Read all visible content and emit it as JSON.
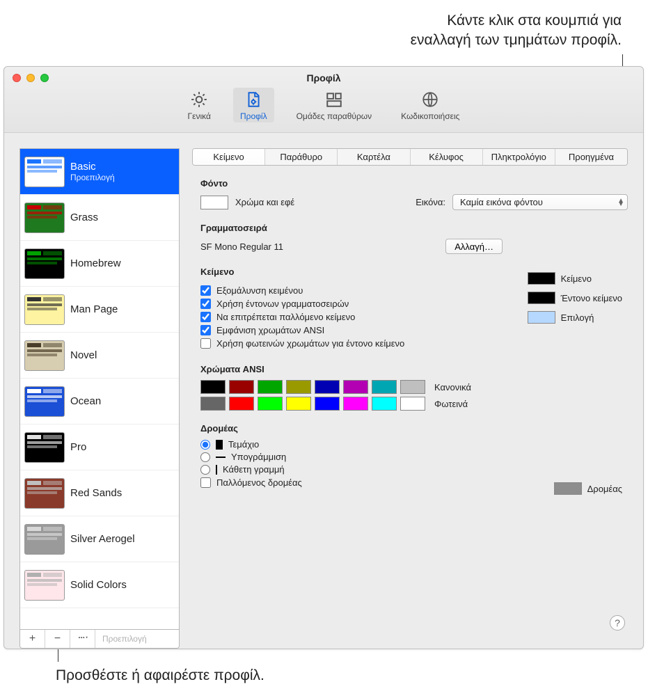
{
  "callouts": {
    "top": "Κάντε κλικ στα κουμπιά για\nεναλλαγή των τμημάτων προφίλ.",
    "bottom": "Προσθέστε ή αφαιρέστε προφίλ."
  },
  "window": {
    "title": "Προφίλ",
    "toolbar": [
      {
        "label": "Γενικά",
        "selected": false
      },
      {
        "label": "Προφίλ",
        "selected": true
      },
      {
        "label": "Ομάδες παραθύρων",
        "selected": false
      },
      {
        "label": "Κωδικοποιήσεις",
        "selected": false
      }
    ]
  },
  "sidebar": {
    "profiles": [
      {
        "name": "Basic",
        "default_label": "Προεπιλογή",
        "selected": true,
        "bg": "#ffffff",
        "accent": "#1a73ff"
      },
      {
        "name": "Grass",
        "selected": false,
        "bg": "#1f7a1f",
        "accent": "#c60000"
      },
      {
        "name": "Homebrew",
        "selected": false,
        "bg": "#000000",
        "accent": "#00a000"
      },
      {
        "name": "Man Page",
        "selected": false,
        "bg": "#fdf3a0",
        "accent": "#333333"
      },
      {
        "name": "Novel",
        "selected": false,
        "bg": "#d7cdb0",
        "accent": "#4a3d2a"
      },
      {
        "name": "Ocean",
        "selected": false,
        "bg": "#1a4fd6",
        "accent": "#ffffff"
      },
      {
        "name": "Pro",
        "selected": false,
        "bg": "#000000",
        "accent": "#e0e0e0"
      },
      {
        "name": "Red Sands",
        "selected": false,
        "bg": "#8a3a2a",
        "accent": "#c0c0c0"
      },
      {
        "name": "Silver Aerogel",
        "selected": false,
        "bg": "#9a9a9a",
        "accent": "#d8d8d8"
      },
      {
        "name": "Solid Colors",
        "selected": false,
        "bg": "#ffe6ea",
        "accent": "#b0b0b0"
      }
    ],
    "footer_default": "Προεπιλογή"
  },
  "tabs": [
    {
      "label": "Κείμενο",
      "current": true
    },
    {
      "label": "Παράθυρο",
      "current": false
    },
    {
      "label": "Καρτέλα",
      "current": false
    },
    {
      "label": "Κέλυφος",
      "current": false
    },
    {
      "label": "Πληκτρολόγιο",
      "current": false
    },
    {
      "label": "Προηγμένα",
      "current": false
    }
  ],
  "background": {
    "section": "Φόντο",
    "color_and_effects": "Χρώμα και εφέ",
    "image_label": "Εικόνα:",
    "image_value": "Καμία εικόνα φόντου"
  },
  "font": {
    "section": "Γραμματοσειρά",
    "current": "SF Mono Regular 11",
    "change_btn": "Αλλαγή…"
  },
  "text": {
    "section": "Κείμενο",
    "checks": [
      {
        "label": "Εξομάλυνση κειμένου",
        "checked": true
      },
      {
        "label": "Χρήση έντονων γραμματοσειρών",
        "checked": true
      },
      {
        "label": "Να επιτρέπεται παλλόμενο κείμενο",
        "checked": true
      },
      {
        "label": "Εμφάνιση χρωμάτων ANSI",
        "checked": true
      },
      {
        "label": "Χρήση φωτεινών χρωμάτων για έντονο κείμενο",
        "checked": false
      }
    ],
    "rhs": [
      {
        "label": "Κείμενο",
        "color": "#000000"
      },
      {
        "label": "Έντονο κείμενο",
        "color": "#000000"
      },
      {
        "label": "Επιλογή",
        "color": "#b6d8ff"
      }
    ]
  },
  "ansi": {
    "section": "Χρώματα ANSI",
    "normal_label": "Κανονικά",
    "bright_label": "Φωτεινά",
    "normal": [
      "#000000",
      "#990000",
      "#00a600",
      "#999900",
      "#0000b2",
      "#b200b2",
      "#00a6b2",
      "#bfbfbf"
    ],
    "bright": [
      "#666666",
      "#ff0000",
      "#00ff00",
      "#ffff00",
      "#0000ff",
      "#ff00ff",
      "#00ffff",
      "#ffffff"
    ]
  },
  "cursor": {
    "section": "Δρομέας",
    "shapes": [
      {
        "label": "Τεμάχιο",
        "selected": true
      },
      {
        "label": "Υπογράμμιση",
        "selected": false
      },
      {
        "label": "Κάθετη γραμμή",
        "selected": false
      }
    ],
    "blink": {
      "label": "Παλλόμενος δρομέας",
      "checked": false
    },
    "rhs": {
      "label": "Δρομέας",
      "color": "#8d8d8d"
    }
  }
}
